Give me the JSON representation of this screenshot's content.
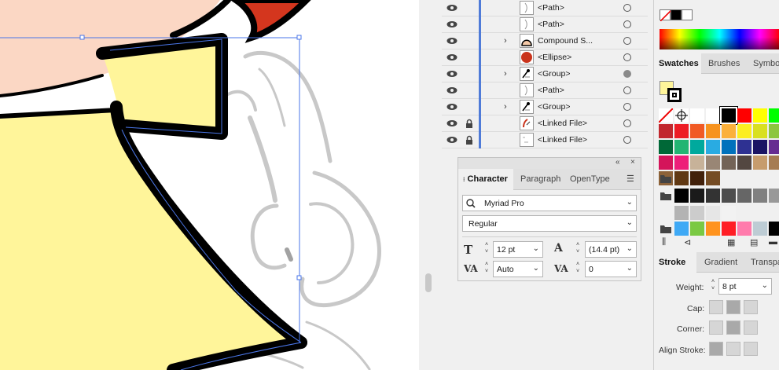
{
  "layers": {
    "rows": [
      {
        "name": "<Path>",
        "twisty": "",
        "locked": false,
        "target_filled": false,
        "thumb": "path"
      },
      {
        "name": "<Path>",
        "twisty": "",
        "locked": false,
        "target_filled": false,
        "thumb": "path"
      },
      {
        "name": "Compound S...",
        "twisty": "›",
        "locked": false,
        "target_filled": false,
        "thumb": "compound"
      },
      {
        "name": "<Ellipse>",
        "twisty": "",
        "locked": false,
        "target_filled": false,
        "thumb": "ellipse"
      },
      {
        "name": "<Group>",
        "twisty": "›",
        "locked": false,
        "target_filled": true,
        "thumb": "group"
      },
      {
        "name": "<Path>",
        "twisty": "",
        "locked": false,
        "target_filled": false,
        "thumb": "path"
      },
      {
        "name": "<Group>",
        "twisty": "›",
        "locked": false,
        "target_filled": false,
        "thumb": "group"
      },
      {
        "name": "<Linked File>",
        "twisty": "",
        "locked": true,
        "target_filled": false,
        "thumb": "linked"
      },
      {
        "name": "<Linked File>",
        "twisty": "",
        "locked": true,
        "target_filled": false,
        "thumb": "linked2"
      }
    ]
  },
  "character": {
    "tabs": [
      "Character",
      "Paragraph",
      "OpenType"
    ],
    "active_tab": "Character",
    "font_family": "Myriad Pro",
    "font_style": "Regular",
    "font_size": "12 pt",
    "leading": "(14.4 pt)",
    "kerning": "Auto",
    "tracking": "0",
    "collapse_icon": "«",
    "close_icon": "×",
    "menu_icon": "☰"
  },
  "swatches_panel": {
    "tabs": [
      "Swatches",
      "Brushes",
      "Symbols"
    ],
    "active_tab": "Swatches",
    "colors": [
      [
        "#ffffff",
        "#000000",
        "#ff0000",
        "#ffff00",
        "#00ff00",
        "#00ffff"
      ],
      [
        "#c1272d",
        "#ed1c24",
        "#f15a24",
        "#f7931e",
        "#fbb03b",
        "#fcee21",
        "#d9e021",
        "#8cc63f"
      ],
      [
        "#006837",
        "#22b573",
        "#00a99d",
        "#29abe2",
        "#0071bc",
        "#2e3192",
        "#1b1464",
        "#662d91"
      ],
      [
        "#d4145a",
        "#ed1e79",
        "#c7b299",
        "#998675",
        "#736357",
        "#534741",
        "#c69c6d",
        "#a67c52"
      ],
      [
        "#8c6239",
        "#603813",
        "#42210b",
        "#754c24"
      ],
      [
        "#000000",
        "#1a1a1a",
        "#333333",
        "#4d4d4d",
        "#666666",
        "#808080",
        "#999999"
      ],
      [
        "#b3b3b3",
        "#cccccc",
        "#e6e6e6",
        "#f2f2f2"
      ],
      [
        "#3fa9f5",
        "#7ac943",
        "#ff931e",
        "#ff1d25",
        "#ff7bac",
        "#bdccd4",
        "#000000"
      ]
    ]
  },
  "stroke_panel": {
    "tabs": [
      "Stroke",
      "Gradient",
      "Transparency"
    ],
    "active_tab": "Stroke",
    "weight_label": "Weight:",
    "weight_value": "8 pt",
    "cap_label": "Cap:",
    "corner_label": "Corner:",
    "align_label": "Align Stroke:"
  },
  "colors": {
    "canvas_yellow": "#fff59a",
    "skin": "#fbd7c4",
    "outline": "#000000",
    "guide_blue": "#4a76e8",
    "layer_bar": "#4f7bd8",
    "fill_swatch": "#fff59a",
    "red_accent": "#d4361e"
  }
}
